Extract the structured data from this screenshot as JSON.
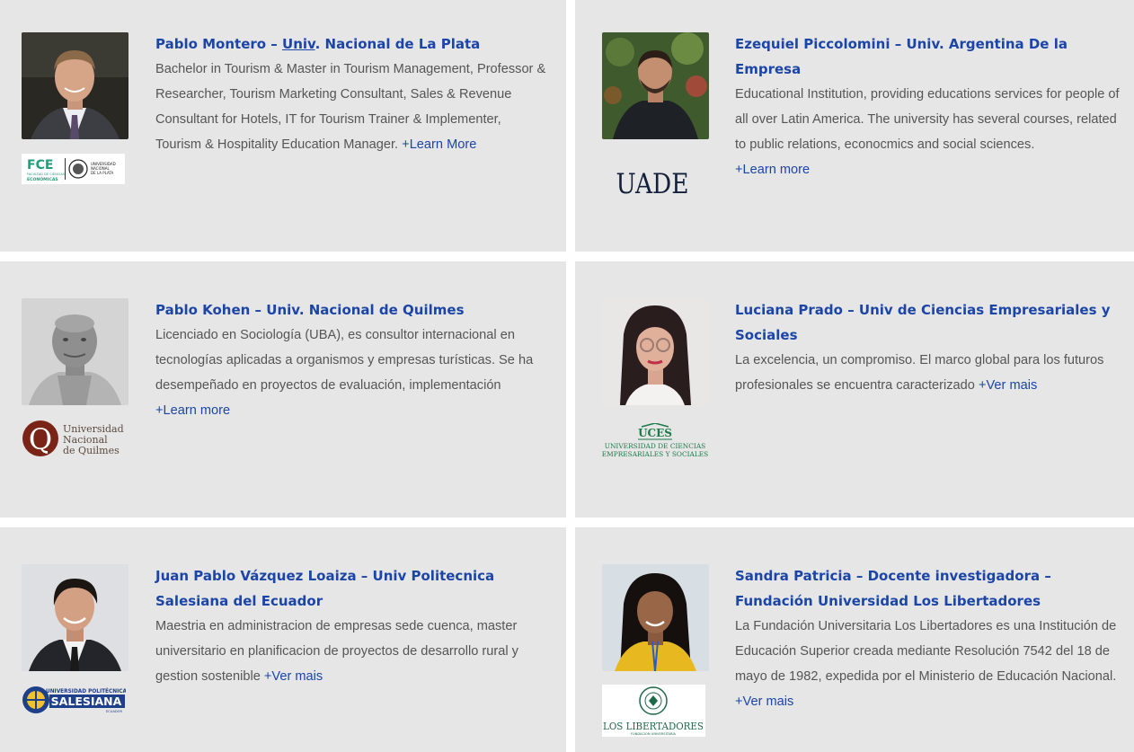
{
  "people": [
    {
      "name_a": "Pablo Montero – ",
      "name_u": "Univ",
      "name_b": ". Nacional de La Plata",
      "desc": "Bachelor in Tourism & Master in Tourism Management, Professor & Researcher, Tourism Marketing Consultant, Sales & Revenue Consultant for Hotels, IT for Tourism Trainer & Implementer, Tourism & Hospitality Education Manager. ",
      "more": "+Learn More",
      "logo": {
        "line1": "FCE",
        "line2": "FACULTAD DE CIENCIAS",
        "line3": "ECONÓMICAS",
        "line4": "UNIVERSIDAD",
        "line5": "NACIONAL",
        "line6": "DE LA PLATA"
      }
    },
    {
      "name": "Ezequiel Piccolomini – Univ. Argentina De la Empresa",
      "desc": "Educational Institution, providing educations services for people of all over Latin America. The university has several courses, related to public relations, econocmics and social sciences. ",
      "more": "+Learn more",
      "logo": {
        "text": "UADE"
      }
    },
    {
      "name": "Pablo Kohen – Univ. Nacional de Quilmes",
      "desc": "Licenciado en Sociología (UBA), es consultor internacional en tecnologías aplicadas a organismos y empresas turísticas. Se ha desempeñado en proyectos de evaluación, implementación ",
      "more": "+Learn more",
      "logo": {
        "letter": "Q",
        "line1": "Universidad",
        "line2": "Nacional",
        "line3": "de Quilmes"
      }
    },
    {
      "name": "Luciana Prado – Univ de Ciencias Empresariales y Sociales",
      "desc": "La excelencia, un compromiso. El marco global para los futuros profesionales se encuentra caracterizado ",
      "more": "+Ver mais",
      "logo": {
        "line1": "UCES",
        "line2": "UNIVERSIDAD DE CIENCIAS",
        "line3": "EMPRESARIALES Y SOCIALES"
      }
    },
    {
      "name": "Juan Pablo Vázquez Loaiza – Univ Politecnica Salesiana del Ecuador",
      "desc": "Maestria en administracion de empresas sede cuenca, master universitario en planificacion de proyectos de desarrollo rural y gestion sostenible ",
      "more": "+Ver mais",
      "logo": {
        "line1": "UNIVERSIDAD POLITÉCNICA",
        "line2": "SALESIANA",
        "line3": "ECUADOR"
      }
    },
    {
      "name": "Sandra Patricia – Docente investigadora – Fundación Universidad Los Libertadores",
      "desc": "La Fundación Universitaria Los Libertadores es una Institución de Educación Superior creada mediante Resolución 7542 del 18 de mayo de 1982, expedida por el Ministerio de Educación Nacional. ",
      "more": "+Ver mais",
      "logo": {
        "line1": "LOS LIBERTADORES",
        "line2": "FUNDACIÓN UNIVERSITARIA"
      }
    }
  ],
  "colors": {
    "card_bg": "#e6e6e6",
    "name": "#1c45a8",
    "desc": "#555555",
    "link": "#1c45a8"
  }
}
